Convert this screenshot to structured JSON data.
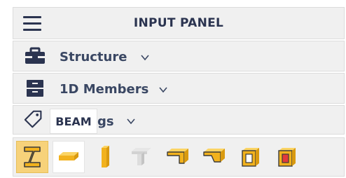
{
  "header": {
    "menu_icon": "hamburger-menu-icon",
    "title": "INPUT PANEL"
  },
  "sections": [
    {
      "label": "Structure",
      "icon": "toolbox-icon"
    },
    {
      "label": "1D Members",
      "icon": "drawer-cabinet-icon"
    },
    {
      "label_visible": "gs",
      "icon": "tag-icon"
    }
  ],
  "tooltip": {
    "text": "BEAM"
  },
  "toolbar": {
    "tools": [
      {
        "name": "beam-tool-icon",
        "state": "highlighted"
      },
      {
        "name": "rectangular-beam-icon",
        "state": "selected"
      },
      {
        "name": "vertical-column-icon",
        "state": "normal"
      },
      {
        "name": "t-section-icon",
        "state": "disabled"
      },
      {
        "name": "l-section-icon",
        "state": "normal"
      },
      {
        "name": "tapered-section-icon",
        "state": "normal"
      },
      {
        "name": "hollow-box-section-icon",
        "state": "normal"
      },
      {
        "name": "filled-box-section-icon",
        "state": "normal"
      }
    ]
  },
  "colors": {
    "accent_yellow": "#f2b21d",
    "text_dark": "#2b3450",
    "panel_bg": "#f0f0f0"
  }
}
